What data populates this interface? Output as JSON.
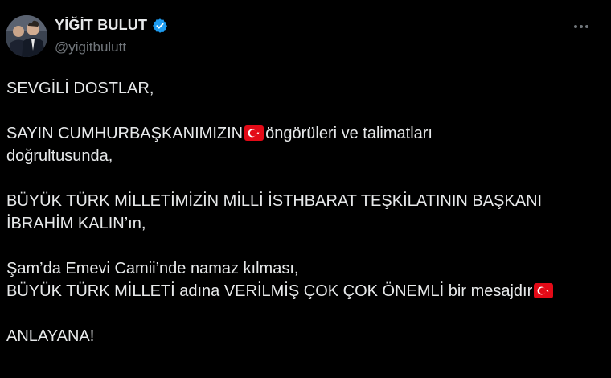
{
  "author": {
    "display_name": "YİĞİT BULUT",
    "handle": "@yigitbulutt",
    "verified_icon": "verified-badge-icon",
    "verified_color": "#1d9bf0"
  },
  "menu": {
    "more_icon": "more-horizontal-icon"
  },
  "tweet": {
    "p1": "SEVGİLİ DOSTLAR,",
    "p2_line1_before_flag": "SAYIN CUMHURBAŞKANIMIZIN",
    "p2_line1_after_flag": "öngörüleri ve talimatları",
    "p2_line2": "doğrultusunda,",
    "p3_line1": "BÜYÜK TÜRK MİLLETİMİZİN MİLLİ İSTHBARAT TEŞKİLATININ BAŞKANI",
    "p3_line2": "İBRAHİM KALIN’ın,",
    "p4_line1": "Şam’da Emevi Camii’nde namaz kılması,",
    "p4_line2_before_flag": "BÜYÜK TÜRK MİLLETİ adına VERİLMİŞ ÇOK ÇOK ÖNEMLİ bir mesajdır",
    "p5": "ANLAYANA!",
    "emoji_icon": "turkey-flag-icon",
    "flag_color": "#e30a17"
  },
  "colors": {
    "background": "#000000",
    "text_primary": "#e7e9ea",
    "text_secondary": "#71767b"
  }
}
